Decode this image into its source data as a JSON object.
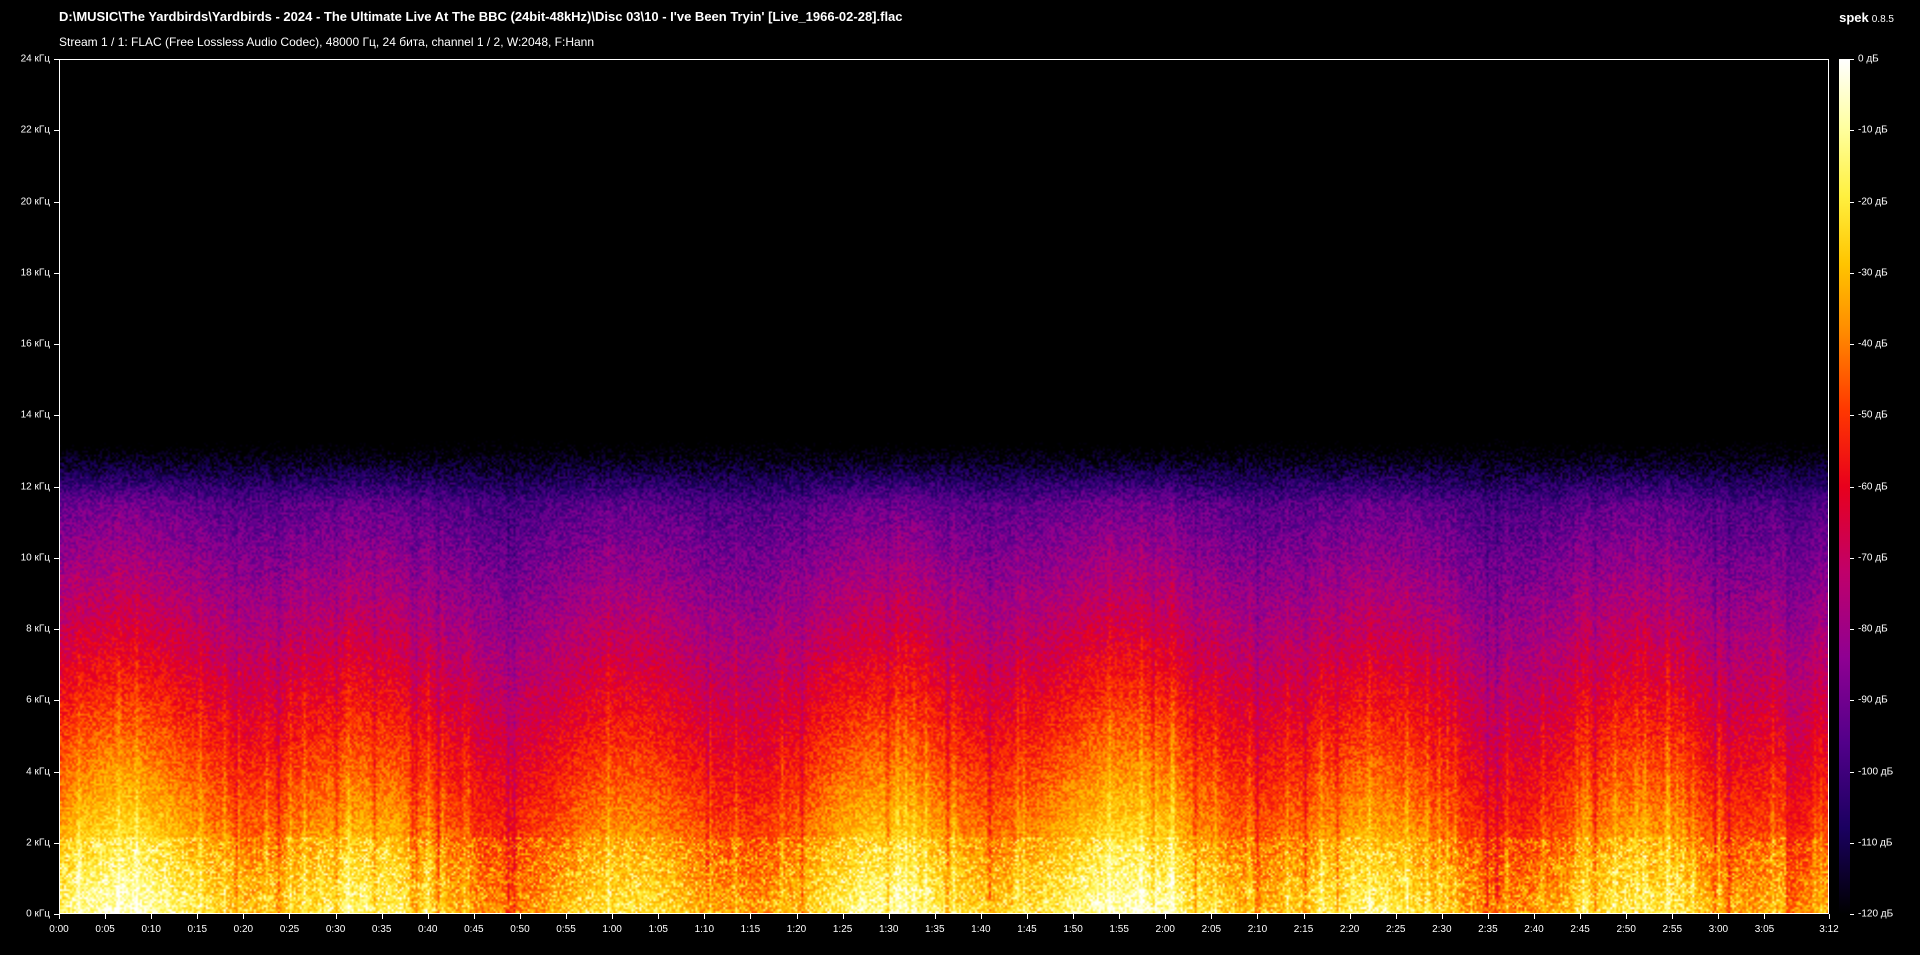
{
  "header": {
    "file_title": "D:\\MUSIC\\The Yardbirds\\Yardbirds - 2024 - The Ultimate Live At The BBC (24bit-48kHz)\\Disc 03\\10 - I've Been Tryin' [Live_1966-02-28].flac",
    "stream_info": "Stream 1 / 1: FLAC (Free Lossless Audio Codec), 48000 Гц, 24 бита, channel 1 / 2, W:2048, F:Hann",
    "app_name": "spek",
    "app_version": "0.8.5"
  },
  "frequency_axis": {
    "labels": [
      "24 кГц",
      "22 кГц",
      "20 кГц",
      "18 кГц",
      "16 кГц",
      "14 кГц",
      "12 кГц",
      "10 кГц",
      "8 кГц",
      "6 кГц",
      "4 кГц",
      "2 кГц",
      "0 кГц"
    ],
    "max_khz": 24
  },
  "time_axis": {
    "labels": [
      "0:00",
      "0:05",
      "0:10",
      "0:15",
      "0:20",
      "0:25",
      "0:30",
      "0:35",
      "0:40",
      "0:45",
      "0:50",
      "0:55",
      "1:00",
      "1:05",
      "1:10",
      "1:15",
      "1:20",
      "1:25",
      "1:30",
      "1:35",
      "1:40",
      "1:45",
      "1:50",
      "1:55",
      "2:00",
      "2:05",
      "2:10",
      "2:15",
      "2:20",
      "2:25",
      "2:30",
      "2:35",
      "2:40",
      "2:45",
      "2:50",
      "2:55",
      "3:00",
      "3:05",
      "3:12"
    ],
    "duration_seconds": 192,
    "step_seconds": 5
  },
  "db_scale": {
    "labels": [
      "0 дБ",
      "-10 дБ",
      "-20 дБ",
      "-30 дБ",
      "-40 дБ",
      "-50 дБ",
      "-60 дБ",
      "-70 дБ",
      "-80 дБ",
      "-90 дБ",
      "-100 дБ",
      "-110 дБ",
      "-120 дБ"
    ],
    "max_db": 0,
    "min_db": -120
  }
}
